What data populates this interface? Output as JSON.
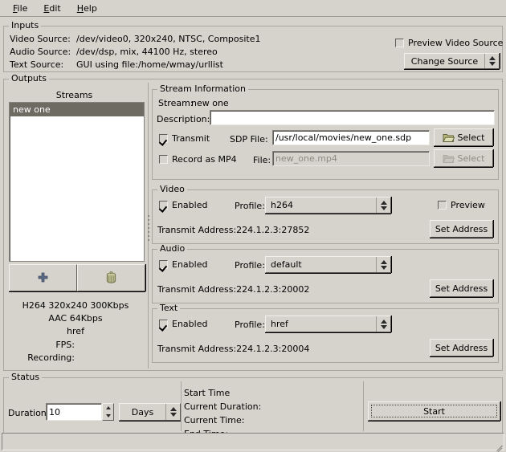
{
  "menubar": {
    "items": [
      {
        "mnemonic": "F",
        "rest": "ile"
      },
      {
        "mnemonic": "E",
        "rest": "dit"
      },
      {
        "mnemonic": "H",
        "rest": "elp"
      }
    ]
  },
  "inputs": {
    "legend": "Inputs",
    "rows": [
      {
        "label": "Video Source:",
        "value": "/dev/video0, 320x240, NTSC, Composite1"
      },
      {
        "label": "Audio Source:",
        "value": "/dev/dsp, mix, 44100 Hz, stereo"
      },
      {
        "label": "Text Source:",
        "value": "GUI using file:/home/wmay/urllist"
      }
    ],
    "preview_checkbox": {
      "label": "Preview Video Source",
      "checked": false
    },
    "change_source_button": {
      "label": "Change Source"
    }
  },
  "outputs": {
    "legend": "Outputs",
    "streams": {
      "header": "Streams",
      "items": [
        {
          "label": "new one",
          "selected": true
        }
      ]
    },
    "add_button": {
      "icon": "plus-icon"
    },
    "delete_button": {
      "icon": "trash-icon"
    },
    "summary": {
      "lines": [
        "H264 320x240 300Kbps",
        "AAC 64Kbps",
        "href"
      ],
      "fps_label": "FPS:",
      "fps_value": "",
      "recording_label": "Recording:",
      "recording_value": ""
    }
  },
  "stream_information": {
    "legend": "Stream Information",
    "stream_label": "Stream:",
    "stream_name": "new one",
    "description_label": "Description:",
    "description_value": "",
    "transmit": {
      "label": "Transmit",
      "checked": true
    },
    "sdp_file_label": "SDP File:",
    "sdp_file_value": "/usr/local/movies/new_one.sdp",
    "sdp_select_button": {
      "label": "Select",
      "enabled": true
    },
    "record": {
      "label": "Record as MP4",
      "checked": false
    },
    "file_label": "File:",
    "file_placeholder": "new_one.mp4",
    "file_select_button": {
      "label": "Select",
      "enabled": false
    }
  },
  "video": {
    "legend": "Video",
    "enabled": {
      "label": "Enabled",
      "checked": true
    },
    "profile_label": "Profile:",
    "profile_value": "h264",
    "preview": {
      "label": "Preview",
      "checked": false
    },
    "transmit_address_label": "Transmit Address:",
    "transmit_address_value": "224.1.2.3:27852",
    "set_address_button": {
      "label": "Set Address"
    }
  },
  "audio": {
    "legend": "Audio",
    "enabled": {
      "label": "Enabled",
      "checked": true
    },
    "profile_label": "Profile:",
    "profile_value": "default",
    "transmit_address_label": "Transmit Address:",
    "transmit_address_value": "224.1.2.3:20002",
    "set_address_button": {
      "label": "Set Address"
    }
  },
  "text": {
    "legend": "Text",
    "enabled": {
      "label": "Enabled",
      "checked": true
    },
    "profile_label": "Profile:",
    "profile_value": "href",
    "transmit_address_label": "Transmit Address:",
    "transmit_address_value": "224.1.2.3:20004",
    "set_address_button": {
      "label": "Set Address"
    }
  },
  "status": {
    "legend": "Status",
    "duration_label": "Duration:",
    "duration_value": "10",
    "units_value": "Days",
    "times": [
      {
        "label": "Start Time",
        "value": ""
      },
      {
        "label": "Current Duration:",
        "value": ""
      },
      {
        "label": "Current Time:",
        "value": ""
      },
      {
        "label": "End Time:",
        "value": ""
      }
    ],
    "start_button": {
      "label": "Start"
    }
  },
  "colors": {
    "window_bg": "#d6d3cc",
    "selection_bg": "#6e6b63",
    "folder_icon": "#a8a872",
    "plus_icon": "#5a6a84",
    "trash_icon": "#b5b58a"
  }
}
